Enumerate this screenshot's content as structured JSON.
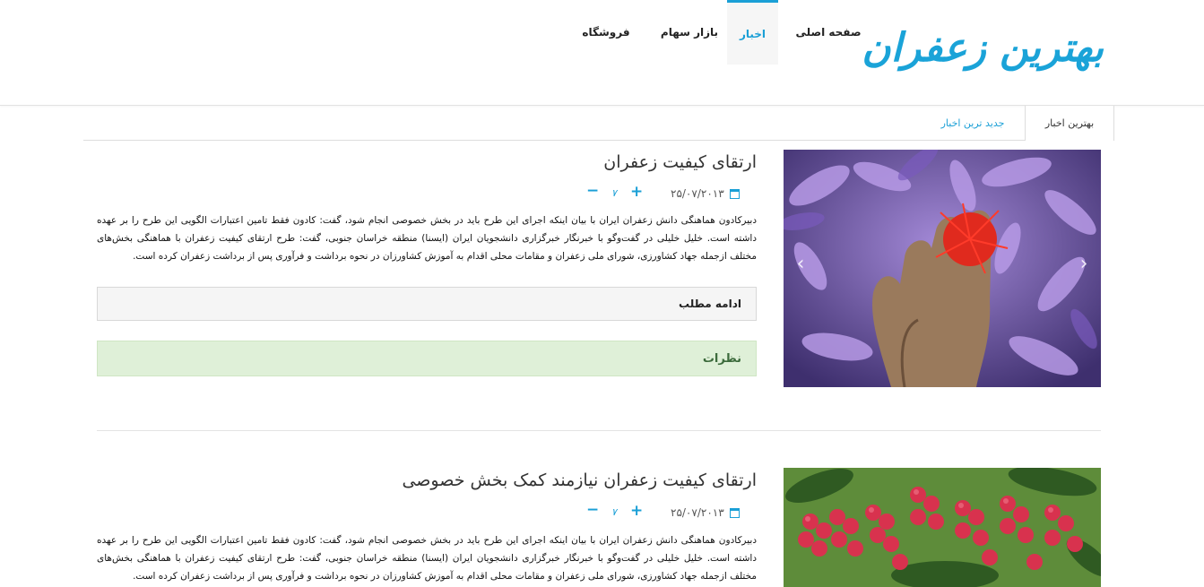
{
  "site": {
    "logo": "بهترین زعفران"
  },
  "nav": [
    {
      "label": "صفحه اصلی"
    },
    {
      "label": "اخبار"
    },
    {
      "label": "بازار سهام"
    },
    {
      "label": "فروشگاه"
    }
  ],
  "tabs": [
    {
      "label": "بهترین اخبار"
    },
    {
      "label": "جدید ترین اخبار"
    }
  ],
  "posts": [
    {
      "title": "ارتقای کیفیت زعفران",
      "date": "۲۵/۰۷/۲۰۱۳",
      "votes": "۷",
      "body": "دبیرکادون هماهنگی دانش زعفران ایران با بیان اینکه اجرای این طرح باید در بخش خصوصی انجام شود، گفت: کادون فقط تامین اعتبارات الگویی این طرح را بر عهده داشته است. خلیل خلیلی در گفت‌وگو با خبرنگار خبرگزاری دانشجویان ایران (ایسنا) منطقه خراسان جنوبی، گفت: طرح ارتقای کیفیت زعفران با هماهنگی بخش‌های مختلف ازجمله جهاد کشاورزی، شورای ملی زعفران و مقامات محلی اقدام به آموزش کشاورزان در نحوه برداشت و فرآوری پس از برداشت زعفران کرده است.",
      "more_label": "ادامه مطلب",
      "comments_label": "نظرات"
    },
    {
      "title": "ارتقای کیفیت زعفران نیازمند کمک بخش خصوصی",
      "date": "۲۵/۰۷/۲۰۱۳",
      "votes": "۷",
      "body": "دبیرکادون هماهنگی دانش زعفران ایران با بیان اینکه اجرای این طرح باید در بخش خصوصی انجام شود، گفت: کادون فقط تامین اعتبارات الگویی این طرح را بر عهده داشته است. خلیل خلیلی در گفت‌وگو با خبرنگار خبرگزاری دانشجویان ایران (ایسنا) منطقه خراسان جنوبی، گفت: طرح ارتقای کیفیت زعفران با هماهنگی بخش‌های مختلف ازجمله جهاد کشاورزی، شورای ملی زعفران و مقامات محلی اقدام به آموزش کشاورزان در نحوه برداشت و فرآوری پس از برداشت زعفران کرده است."
    }
  ],
  "icons": {
    "calendar": "calendar-icon",
    "plus": "plus-icon",
    "minus": "minus-icon",
    "prev": "chevron-left-icon",
    "next": "chevron-right-icon"
  },
  "colors": {
    "accent": "#1a9fd6",
    "success_bg": "#dff0d8",
    "success_text": "#3c6b3c"
  }
}
